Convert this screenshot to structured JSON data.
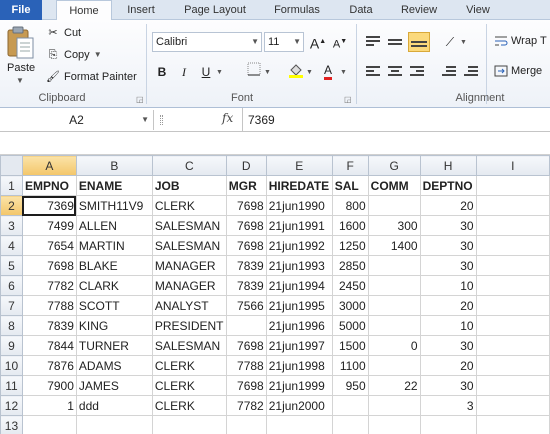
{
  "tabs": [
    {
      "label": "File"
    },
    {
      "label": "Home"
    },
    {
      "label": "Insert"
    },
    {
      "label": "Page Layout"
    },
    {
      "label": "Formulas"
    },
    {
      "label": "Data"
    },
    {
      "label": "Review"
    },
    {
      "label": "View"
    }
  ],
  "clipboard": {
    "paste_label": "Paste",
    "cut_label": "Cut",
    "copy_label": "Copy",
    "format_painter_label": "Format Painter",
    "group_label": "Clipboard"
  },
  "font": {
    "name": "Calibri",
    "size": "11",
    "group_label": "Font",
    "bold": "B",
    "italic": "I",
    "underline": "U",
    "grow": "A",
    "shrink": "A",
    "color_letter": "A"
  },
  "alignment": {
    "wrap_label": "Wrap T",
    "merge_label": "Merge",
    "group_label": "Alignment"
  },
  "formula_bar": {
    "name_box": "A2",
    "fx": "fx",
    "value": "7369"
  },
  "sheet": {
    "columns": [
      "A",
      "B",
      "C",
      "D",
      "E",
      "F",
      "G",
      "H",
      "I"
    ],
    "rows": [
      {
        "num": "1",
        "cells": [
          "EMPNO",
          "ENAME",
          "JOB",
          "MGR",
          "HIREDATE",
          "SAL",
          "COMM",
          "DEPTNO",
          ""
        ]
      },
      {
        "num": "2",
        "cells": [
          "7369",
          "SMITH11V9",
          "CLERK",
          "7698",
          "21jun1990",
          "800",
          "",
          "20",
          ""
        ]
      },
      {
        "num": "3",
        "cells": [
          "7499",
          "ALLEN",
          "SALESMAN",
          "7698",
          "21jun1991",
          "1600",
          "300",
          "30",
          ""
        ]
      },
      {
        "num": "4",
        "cells": [
          "7654",
          "MARTIN",
          "SALESMAN",
          "7698",
          "21jun1992",
          "1250",
          "1400",
          "30",
          ""
        ]
      },
      {
        "num": "5",
        "cells": [
          "7698",
          "BLAKE",
          "MANAGER",
          "7839",
          "21jun1993",
          "2850",
          "",
          "30",
          ""
        ]
      },
      {
        "num": "6",
        "cells": [
          "7782",
          "CLARK",
          "MANAGER",
          "7839",
          "21jun1994",
          "2450",
          "",
          "10",
          ""
        ]
      },
      {
        "num": "7",
        "cells": [
          "7788",
          "SCOTT",
          "ANALYST",
          "7566",
          "21jun1995",
          "3000",
          "",
          "20",
          ""
        ]
      },
      {
        "num": "8",
        "cells": [
          "7839",
          "KING",
          "PRESIDENT",
          "",
          "21jun1996",
          "5000",
          "",
          "10",
          ""
        ]
      },
      {
        "num": "9",
        "cells": [
          "7844",
          "TURNER",
          "SALESMAN",
          "7698",
          "21jun1997",
          "1500",
          "0",
          "30",
          ""
        ]
      },
      {
        "num": "10",
        "cells": [
          "7876",
          "ADAMS",
          "CLERK",
          "7788",
          "21jun1998",
          "1100",
          "",
          "20",
          ""
        ]
      },
      {
        "num": "11",
        "cells": [
          "7900",
          "JAMES",
          "CLERK",
          "7698",
          "21jun1999",
          "950",
          "22",
          "30",
          ""
        ]
      },
      {
        "num": "12",
        "cells": [
          "1",
          "ddd",
          "CLERK",
          "7782",
          "21jun2000",
          "",
          "",
          "3",
          ""
        ]
      },
      {
        "num": "13",
        "cells": [
          "",
          "",
          "",
          "",
          "",
          "",
          "",
          "",
          ""
        ]
      }
    ],
    "active_cell": "A2"
  },
  "colors": {
    "file_tab": "#2a62b8",
    "selection_header": "#f3c66a",
    "highlight_button": "#fbd97c",
    "font_color_red": "#e02020",
    "highlight_yellow": "#ffff00"
  }
}
